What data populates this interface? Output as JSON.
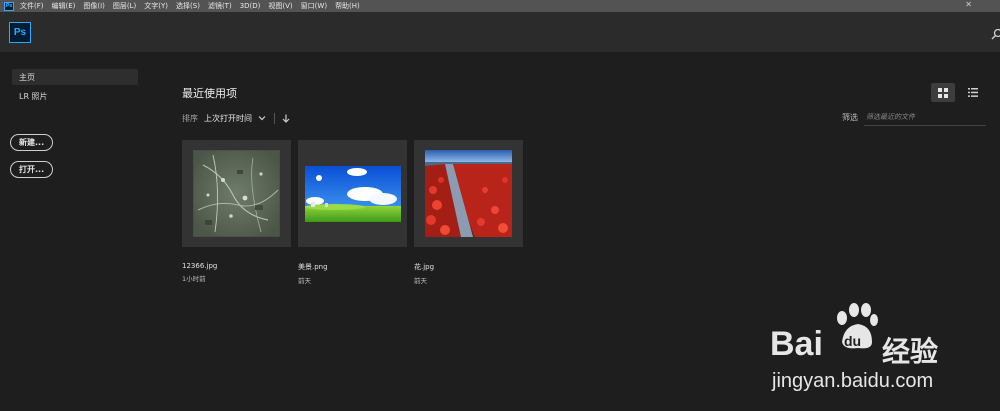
{
  "menubar": {
    "app_icon": "Ps",
    "items": [
      "文件(F)",
      "编辑(E)",
      "图像(I)",
      "图层(L)",
      "文字(Y)",
      "选择(S)",
      "滤镜(T)",
      "3D(D)",
      "视图(V)",
      "窗口(W)",
      "帮助(H)"
    ],
    "close_glyph": "✕"
  },
  "header": {
    "logo": "Ps",
    "search_icon": "search-icon"
  },
  "sidebar": {
    "items": [
      {
        "label": "主页",
        "active": true
      },
      {
        "label": "LR 照片",
        "active": false
      }
    ],
    "new_button": "新建...",
    "open_button": "打开..."
  },
  "main": {
    "title": "最近使用项",
    "sort_label": "排序",
    "sort_value": "上次打开时间",
    "filter_label": "筛选",
    "filter_placeholder": "筛选最近的文件"
  },
  "files": [
    {
      "name": "12366.jpg",
      "time": "1小时前",
      "thumb": "aerial-map"
    },
    {
      "name": "美景.png",
      "time": "前天",
      "thumb": "blue-sky-meadow"
    },
    {
      "name": "花.jpg",
      "time": "前天",
      "thumb": "red-tulip-field"
    }
  ],
  "watermark": {
    "brand": "Bai",
    "brand2": "du",
    "suffix": "经验",
    "url": "jingyan.baidu.com"
  },
  "colors": {
    "accent": "#31a8ff",
    "background": "#1e1e1e",
    "header": "#2b2b2b",
    "menubar": "#535353"
  }
}
